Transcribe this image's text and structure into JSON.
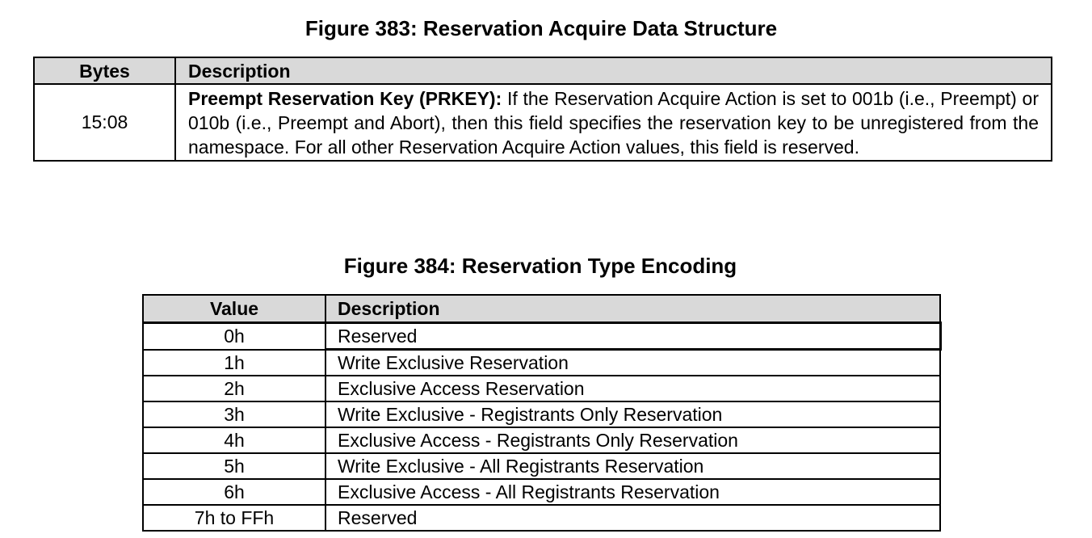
{
  "figure383": {
    "title": "Figure 383: Reservation Acquire Data Structure",
    "headers": {
      "bytes": "Bytes",
      "description": "Description"
    },
    "row": {
      "bytes": "15:08",
      "field_name": "Preempt Reservation Key (PRKEY):",
      "text": " If the Reservation Acquire Action is set to 001b (i.e., Preempt) or 010b (i.e., Preempt and Abort), then this field specifies the reservation key to be unregistered from the namespace. For all other Reservation Acquire Action values, this field is reserved."
    }
  },
  "figure384": {
    "title": "Figure 384: Reservation Type Encoding",
    "headers": {
      "value": "Value",
      "description": "Description"
    },
    "rows": [
      {
        "value": "0h",
        "description": "Reserved"
      },
      {
        "value": "1h",
        "description": "Write Exclusive Reservation"
      },
      {
        "value": "2h",
        "description": "Exclusive Access Reservation"
      },
      {
        "value": "3h",
        "description": "Write Exclusive - Registrants Only Reservation"
      },
      {
        "value": "4h",
        "description": "Exclusive Access - Registrants Only Reservation"
      },
      {
        "value": "5h",
        "description": "Write Exclusive - All Registrants Reservation"
      },
      {
        "value": "6h",
        "description": "Exclusive Access - All Registrants Reservation"
      },
      {
        "value": "7h to FFh",
        "description": "Reserved"
      }
    ]
  }
}
